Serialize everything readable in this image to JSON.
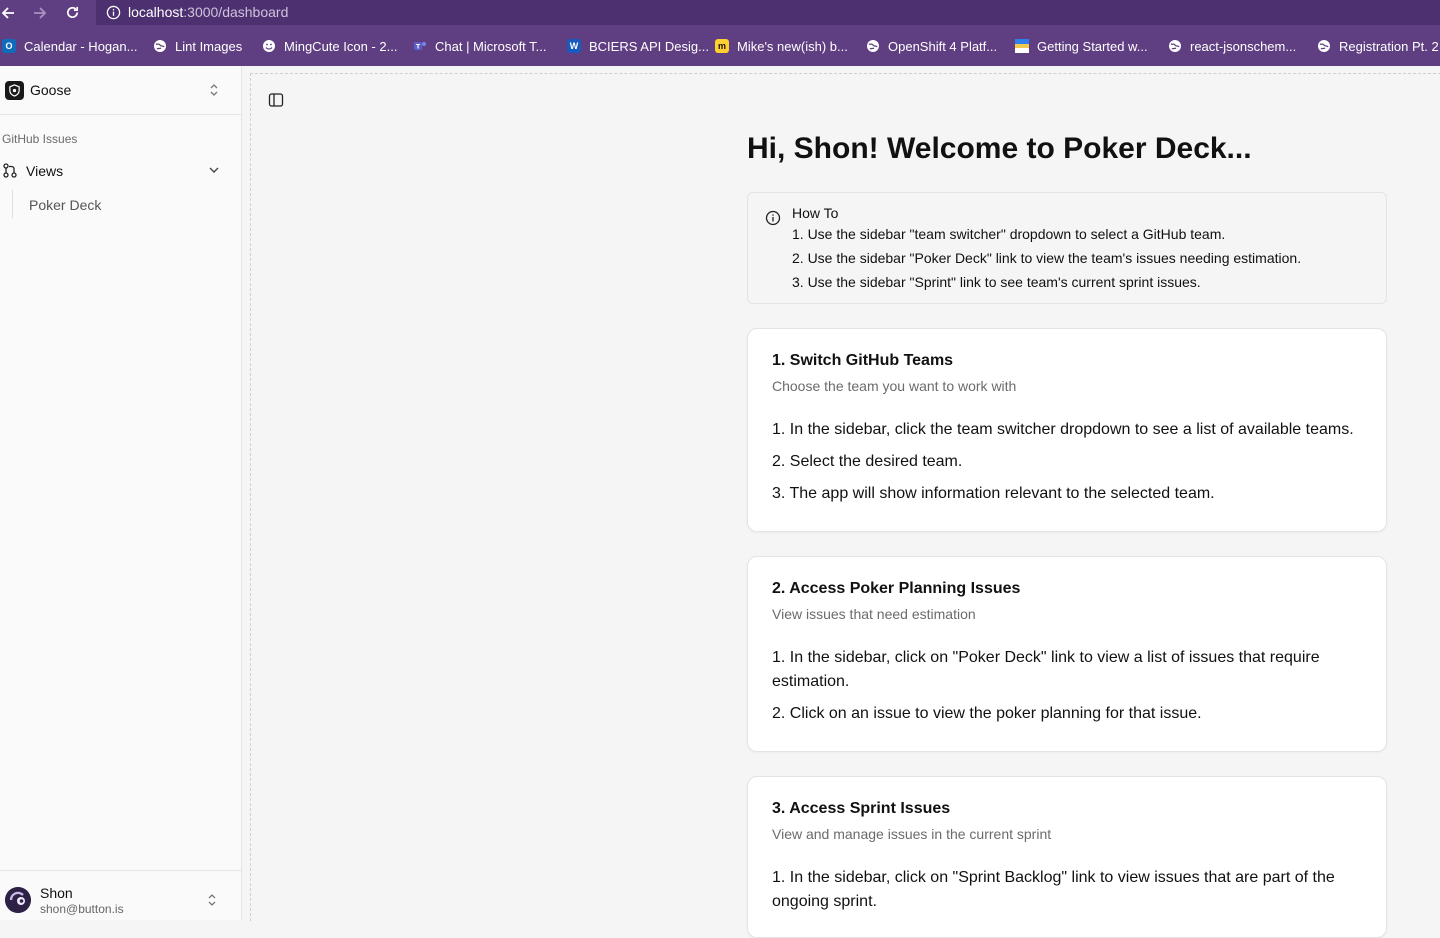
{
  "browser": {
    "url_host": "localhost",
    "url_path": ":3000/dashboard",
    "bookmarks": [
      {
        "label": "Calendar - Hogan...",
        "icon": "outlook-icon",
        "color": "#0f6cbd"
      },
      {
        "label": "Lint Images",
        "icon": "globe-icon",
        "color": "#ffffff"
      },
      {
        "label": "MingCute Icon - 2...",
        "icon": "smiley-icon",
        "color": "#ffffff"
      },
      {
        "label": "Chat | Microsoft T...",
        "icon": "teams-icon",
        "color": "#5b5fc7"
      },
      {
        "label": "BCIERS API Desig...",
        "icon": "word-icon",
        "color": "#185abd"
      },
      {
        "label": "Mike's new(ish) b...",
        "icon": "miro-icon",
        "color": "#ffd02f"
      },
      {
        "label": "OpenShift 4 Platf...",
        "icon": "globe-icon",
        "color": "#ffffff"
      },
      {
        "label": "Getting Started w...",
        "icon": "flag-icon",
        "color": "#f2c94c"
      },
      {
        "label": "react-jsonschem...",
        "icon": "globe-icon",
        "color": "#ffffff"
      },
      {
        "label": "Registration Pt. 2",
        "icon": "globe-icon",
        "color": "#ffffff"
      }
    ]
  },
  "sidebar": {
    "team_name": "Goose",
    "group_label": "GitHub Issues",
    "views_label": "Views",
    "items": [
      {
        "label": "Poker Deck"
      }
    ],
    "user": {
      "name": "Shon",
      "email": "shon@button.is"
    }
  },
  "main": {
    "title": "Hi, Shon! Welcome to Poker Deck...",
    "howto": {
      "title": "How To",
      "items": [
        "1. Use the sidebar \"team switcher\" dropdown to select a GitHub team.",
        "2. Use the sidebar \"Poker Deck\" link to view the team's issues needing estimation.",
        "3. Use the sidebar \"Sprint\" link to see team's current sprint issues."
      ]
    },
    "cards": [
      {
        "title": "1. Switch GitHub Teams",
        "subtitle": "Choose the team you want to work with",
        "steps": [
          "1. In the sidebar, click the team switcher dropdown to see a list of available teams.",
          "2. Select the desired team.",
          "3. The app will show information relevant to the selected team."
        ]
      },
      {
        "title": "2. Access Poker Planning Issues",
        "subtitle": "View issues that need estimation",
        "steps": [
          "1. In the sidebar, click on \"Poker Deck\" link to view a list of issues that require estimation.",
          "2. Click on an issue to view the poker planning for that issue."
        ]
      },
      {
        "title": "3. Access Sprint Issues",
        "subtitle": "View and manage issues in the current sprint",
        "steps": [
          "1. In the sidebar, click on \"Sprint Backlog\" link to view issues that are part of the ongoing sprint."
        ]
      }
    ]
  },
  "colors": {
    "chrome": "#5f3f82",
    "page_bg": "#f5f5f5",
    "card_bg": "#ffffff"
  }
}
